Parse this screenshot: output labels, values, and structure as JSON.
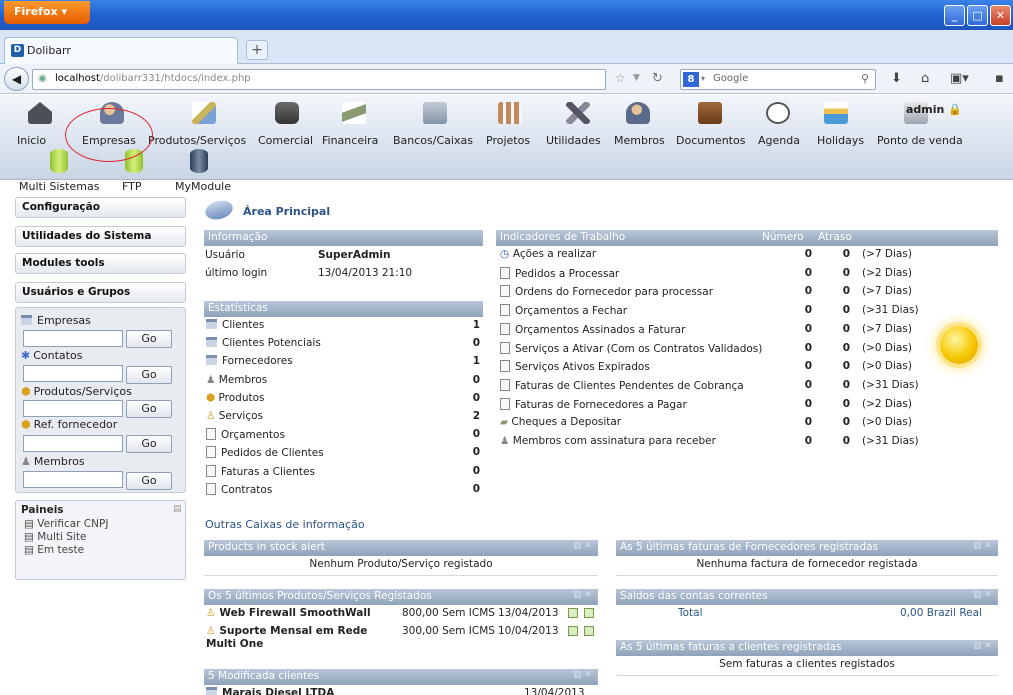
{
  "browser": {
    "menu_button": "Firefox",
    "tab_title": "Dolibarr",
    "url_host": "localhost",
    "url_path": "/dolibarr331/htdocs/index.php",
    "search_placeholder": "Google"
  },
  "topmenu": {
    "items": [
      {
        "label": "Inicio",
        "icon": "home-icon"
      },
      {
        "label": "Empresas",
        "icon": "companies-icon"
      },
      {
        "label": "Produtos/Serviços",
        "icon": "products-icon"
      },
      {
        "label": "Comercial",
        "icon": "commercial-icon"
      },
      {
        "label": "Financeira",
        "icon": "money-icon"
      },
      {
        "label": "Bancos/Caixas",
        "icon": "bank-icon"
      },
      {
        "label": "Projetos",
        "icon": "projects-icon"
      },
      {
        "label": "Utilidades",
        "icon": "tools-icon"
      },
      {
        "label": "Membros",
        "icon": "members-icon"
      },
      {
        "label": "Documentos",
        "icon": "documents-icon"
      },
      {
        "label": "Agenda",
        "icon": "clock-icon"
      },
      {
        "label": "Holidays",
        "icon": "holidays-icon"
      },
      {
        "label": "Ponto de venda",
        "icon": "pos-icon"
      }
    ],
    "modules": [
      "Multi Sistemas",
      "FTP",
      "MyModule"
    ],
    "user": "admin"
  },
  "left": {
    "menu": [
      "Configuração",
      "Utilidades do Sistema",
      "Modules tools",
      "Usuários e Grupos"
    ],
    "search": {
      "items": [
        "Empresas",
        "Contatos",
        "Produtos/Serviços",
        "Ref. fornecedor",
        "Membros"
      ],
      "go": "Go"
    },
    "paineis": {
      "title": "Paineis",
      "items": [
        "Verificar CNPJ",
        "Multi Site",
        "Em teste"
      ]
    }
  },
  "main": {
    "page_title": "Área Principal",
    "info": {
      "title": "Informação",
      "user_label": "Usuário",
      "user_value": "SuperAdmin",
      "login_label": "último login",
      "login_value": "13/04/2013 21:10"
    },
    "stats": {
      "title": "Estatísticas",
      "rows": [
        {
          "label": "Clientes",
          "value": "1"
        },
        {
          "label": "Clientes Potenciais",
          "value": "0"
        },
        {
          "label": "Fornecedores",
          "value": "1"
        },
        {
          "label": "Membros",
          "value": "0"
        },
        {
          "label": "Produtos",
          "value": "0"
        },
        {
          "label": "Serviços",
          "value": "2"
        },
        {
          "label": "Orçamentos",
          "value": "0"
        },
        {
          "label": "Pedidos de Clientes",
          "value": "0"
        },
        {
          "label": "Faturas a Clientes",
          "value": "0"
        },
        {
          "label": "Contratos",
          "value": "0"
        }
      ]
    },
    "indicators": {
      "title": "Indicadores de Trabalho",
      "col_number": "Número",
      "col_delay": "Atraso",
      "rows": [
        {
          "label": "Ações a realizar",
          "number": "0",
          "delay": "0",
          "days": "(>7 Dias)"
        },
        {
          "label": "Pedidos a Processar",
          "number": "0",
          "delay": "0",
          "days": "(>2 Dias)"
        },
        {
          "label": "Ordens do Fornecedor para processar",
          "number": "0",
          "delay": "0",
          "days": "(>7 Dias)"
        },
        {
          "label": "Orçamentos a Fechar",
          "number": "0",
          "delay": "0",
          "days": "(>31 Dias)"
        },
        {
          "label": "Orçamentos Assinados a Faturar",
          "number": "0",
          "delay": "0",
          "days": "(>7 Dias)"
        },
        {
          "label": "Serviços a Ativar (Com os Contratos Validados)",
          "number": "0",
          "delay": "0",
          "days": "(>0 Dias)"
        },
        {
          "label": "Serviços Ativos Expirados",
          "number": "0",
          "delay": "0",
          "days": "(>0 Dias)"
        },
        {
          "label": "Faturas de Clientes Pendentes de Cobrança",
          "number": "0",
          "delay": "0",
          "days": "(>31 Dias)"
        },
        {
          "label": "Faturas de Fornecedores a Pagar",
          "number": "0",
          "delay": "0",
          "days": "(>2 Dias)"
        },
        {
          "label": "Cheques a Depositar",
          "number": "0",
          "delay": "0",
          "days": "(>0 Dias)"
        },
        {
          "label": "Membros com assinatura para receber",
          "number": "0",
          "delay": "0",
          "days": "(>31 Dias)"
        }
      ]
    },
    "other_boxes_title": "Outras Caixas de informação",
    "stock_alert": {
      "title": "Products in stock alert",
      "empty": "Nenhum Produto/Serviço registado"
    },
    "supplier_invoices": {
      "title": "As 5 últimas faturas de Fornecedores registradas",
      "empty": "Nenhuma factura de fornecedor registada"
    },
    "last_products": {
      "title": "Os 5 últimos Produtos/Serviços Registados",
      "rows": [
        {
          "name": "Web Firewall SmoothWall",
          "price": "800,00 Sem ICMS",
          "date": "13/04/2013"
        },
        {
          "name": "Suporte Mensal em Rede Multi One",
          "price": "300,00 Sem ICMS",
          "date": "10/04/2013"
        }
      ]
    },
    "balances": {
      "title": "Saldos das contas correntes",
      "total_label": "Total",
      "total_value": "0,00 Brazil Real"
    },
    "client_invoices": {
      "title": "As 5 últimas faturas a clientes registradas",
      "empty": "Sem faturas a clientes registados"
    },
    "modified_clients": {
      "title": "5 Modificada clientes",
      "rows": [
        {
          "name": "Marais Diesel LTDA",
          "date": "13/04/2013"
        }
      ]
    }
  }
}
